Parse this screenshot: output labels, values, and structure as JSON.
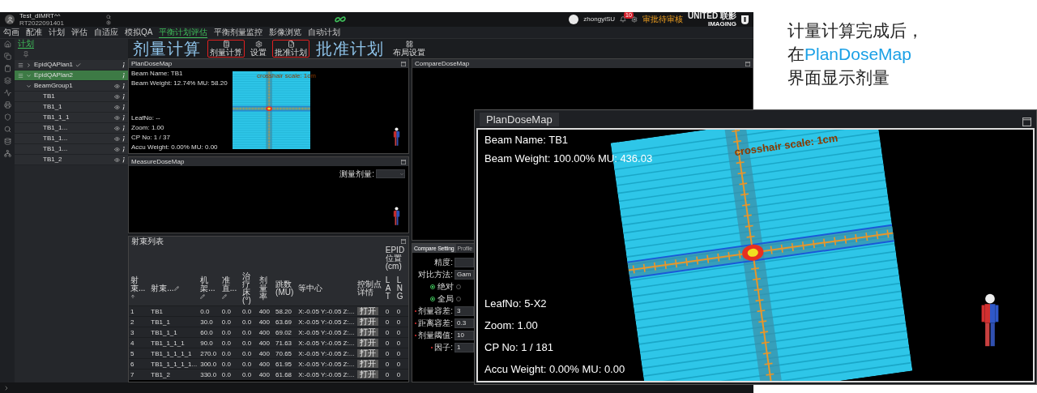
{
  "header": {
    "patient_name": "Test_dIMRT^^",
    "patient_id": "RT2022091401",
    "user": "zhongyiSU",
    "notifications": "10",
    "status": "审批待审核",
    "brand_top": "UNITED 联影",
    "brand_bottom": "IMAGING"
  },
  "nav": [
    {
      "label": "勾画",
      "selected": false
    },
    {
      "label": "配准",
      "selected": false
    },
    {
      "label": "计划",
      "selected": false
    },
    {
      "label": "评估",
      "selected": false
    },
    {
      "label": "自适应",
      "selected": false
    },
    {
      "label": "模拟QA",
      "selected": false
    },
    {
      "label": "平衡计划评估",
      "selected": true
    },
    {
      "label": "平衡剂量监控",
      "selected": false
    },
    {
      "label": "影像浏览",
      "selected": false
    },
    {
      "label": "自动计划",
      "selected": false
    }
  ],
  "sidebar": {
    "tab": {
      "label": "计划",
      "selected": true
    },
    "plans": [
      {
        "name": "EpidQAPlan1",
        "selected": false,
        "expanded": false,
        "approved": true
      },
      {
        "name": "EpidQAPlan2",
        "selected": true,
        "expanded": true,
        "approved": false,
        "children": [
          {
            "name": "BeamGroup1",
            "expanded": true,
            "children": [
              {
                "name": "TB1"
              },
              {
                "name": "TB1_1"
              },
              {
                "name": "TB1_1_1"
              },
              {
                "name": "TB1_1..."
              },
              {
                "name": "TB1_1..."
              },
              {
                "name": "TB1_1..."
              },
              {
                "name": "TB1_2"
              }
            ]
          }
        ]
      }
    ]
  },
  "toolbar": [
    {
      "kind": "callout",
      "text": "剂量计算"
    },
    {
      "kind": "button",
      "label": "剂量计算",
      "highlighted": true
    },
    {
      "kind": "button",
      "label": "设置",
      "highlighted": false
    },
    {
      "kind": "button",
      "label": "批准计划",
      "highlighted": true
    },
    {
      "kind": "callout",
      "text": "批准计划"
    },
    {
      "kind": "button",
      "label": "布局设置",
      "highlighted": false
    }
  ],
  "plan_dose_map": {
    "title": "PlanDoseMap",
    "info_top": [
      "Beam Name: TB1",
      "Beam Weight: 12.74% MU: 58.20"
    ],
    "info_bottom": [
      "LeafNo: --",
      "Zoom: 1.00",
      "CP No: 1 / 37",
      "Accu Weight: 0.00% MU: 0.00"
    ],
    "crosshair_label": "crosshair scale: 1cm"
  },
  "measure_dose_map": {
    "title": "MeasureDoseMap",
    "select_label": "测量剂量:"
  },
  "compare_dose_map": {
    "title": "CompareDoseMap"
  },
  "compare_settings": {
    "tabs": [
      {
        "label": "Compare Setting",
        "selected": true
      },
      {
        "label": "Profile",
        "selected": false
      }
    ],
    "fields": [
      {
        "kind": "input",
        "label": "精度:",
        "required": false
      },
      {
        "kind": "select",
        "label": "对比方法:",
        "value": "Gam",
        "required": false
      },
      {
        "kind": "radio",
        "options": [
          {
            "label": "绝对",
            "selected": true
          },
          {
            "selected": false
          }
        ]
      },
      {
        "kind": "radio",
        "options": [
          {
            "label": "全局",
            "selected": true
          },
          {
            "selected": false
          }
        ]
      },
      {
        "kind": "input",
        "label": "剂量容差:",
        "value": "3",
        "required": true
      },
      {
        "kind": "input",
        "label": "距离容差:",
        "value": "0.3",
        "required": true
      },
      {
        "kind": "input",
        "label": "剂量阈值:",
        "value": "10",
        "required": true
      },
      {
        "kind": "input",
        "label": "因子:",
        "value": "1",
        "required": true
      }
    ]
  },
  "beam_table": {
    "title": "射束列表",
    "group_header": "EPID位置(cm)",
    "columns": [
      {
        "label": "射束...",
        "kind": "text"
      },
      {
        "label": "射束...",
        "kind": "text"
      },
      {
        "label": "机架...",
        "kind": "text"
      },
      {
        "label": "准直...",
        "kind": "text"
      },
      {
        "label": "治疗床(°)",
        "kind": "text"
      },
      {
        "label": "剂量率",
        "kind": "text"
      },
      {
        "label": "跳数(MU)",
        "kind": "text"
      },
      {
        "label": "等中心",
        "kind": "text"
      },
      {
        "label": "控制点详情",
        "kind": "button"
      },
      {
        "label": "LAT",
        "kind": "text"
      },
      {
        "label": "LNG",
        "kind": "text"
      }
    ],
    "rows": [
      [
        "1",
        "TB1",
        "0.0",
        "0.0",
        "0.0",
        "400",
        "58.20",
        "X:-0.05 Y:-0.05 Z:...",
        "打开",
        "0",
        "0"
      ],
      [
        "2",
        "TB1_1",
        "30.0",
        "0.0",
        "0.0",
        "400",
        "63.69",
        "X:-0.05 Y:-0.05 Z:...",
        "打开",
        "0",
        "0"
      ],
      [
        "3",
        "TB1_1_1",
        "60.0",
        "0.0",
        "0.0",
        "400",
        "69.02",
        "X:-0.05 Y:-0.05 Z:...",
        "打开",
        "0",
        "0"
      ],
      [
        "4",
        "TB1_1_1_1",
        "90.0",
        "0.0",
        "0.0",
        "400",
        "71.63",
        "X:-0.05 Y:-0.05 Z:...",
        "打开",
        "0",
        "0"
      ],
      [
        "5",
        "TB1_1_1_1_1",
        "270.0",
        "0.0",
        "0.0",
        "400",
        "70.65",
        "X:-0.05 Y:-0.05 Z:...",
        "打开",
        "0",
        "0"
      ],
      [
        "6",
        "TB1_1_1_1_1...",
        "300.0",
        "0.0",
        "0.0",
        "400",
        "61.95",
        "X:-0.05 Y:-0.05 Z:...",
        "打开",
        "0",
        "0"
      ],
      [
        "7",
        "TB1_2",
        "330.0",
        "0.0",
        "0.0",
        "400",
        "61.68",
        "X:-0.05 Y:-0.05 Z:...",
        "打开",
        "0",
        "0"
      ]
    ]
  },
  "annotation": {
    "lines": [
      [
        {
          "text": "计量计算完成后，",
          "highlight": false
        }
      ],
      [
        {
          "text": "在",
          "highlight": false
        },
        {
          "text": "PlanDoseMap",
          "highlight": true
        }
      ],
      [
        {
          "text": "界面显示剂量",
          "highlight": false
        }
      ]
    ]
  },
  "zoomed_plan_dose_map": {
    "title": "PlanDoseMap",
    "info_top": [
      "Beam Name: TB1",
      "Beam Weight: 100.00% MU: 436.03"
    ],
    "info_bottom": [
      "LeafNo: 5-X2",
      "Zoom: 1.00",
      "CP No: 1 / 181",
      "Accu Weight: 0.00% MU: 0.00"
    ],
    "crosshair_label": "crosshair scale: 1cm"
  }
}
